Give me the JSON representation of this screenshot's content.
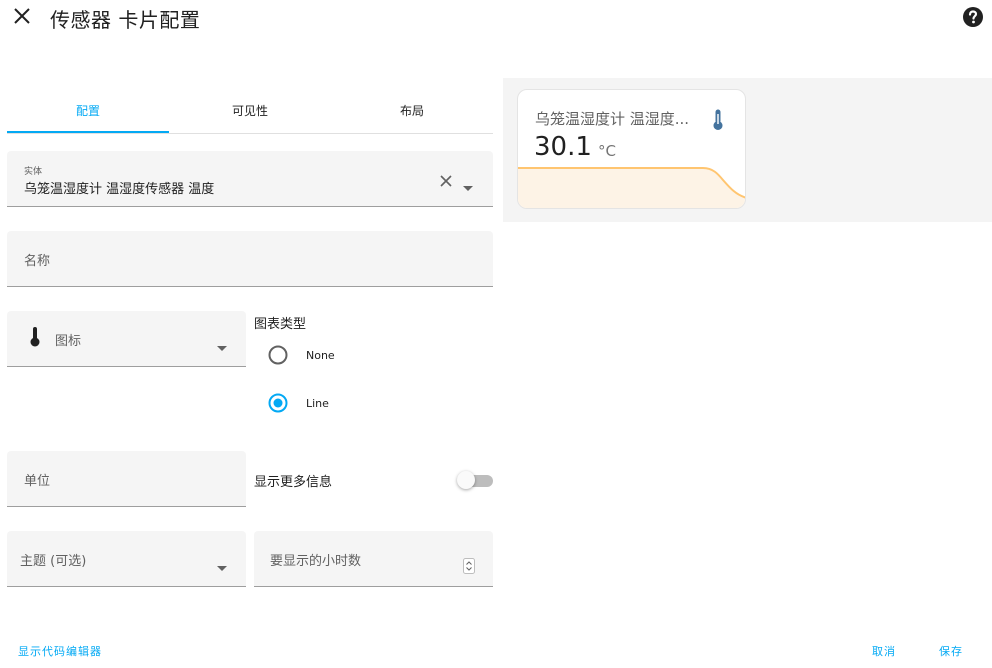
{
  "header": {
    "title": "传感器 卡片配置",
    "close_icon": "close-icon",
    "help_icon": "help-circle-icon"
  },
  "tabs": [
    {
      "label": "配置",
      "active": true
    },
    {
      "label": "可见性",
      "active": false
    },
    {
      "label": "布局",
      "active": false
    }
  ],
  "form": {
    "entity": {
      "label": "实体",
      "value": "乌笼温湿度计  温湿度传感器 温度"
    },
    "name": {
      "placeholder": "名称"
    },
    "icon": {
      "placeholder": "图标",
      "icon": "thermometer-icon"
    },
    "chart_type": {
      "label": "图表类型",
      "options": [
        {
          "label": "None",
          "selected": false
        },
        {
          "label": "Line",
          "selected": true
        }
      ]
    },
    "unit": {
      "placeholder": "单位"
    },
    "show_more_info": {
      "label": "显示更多信息",
      "enabled": false
    },
    "theme": {
      "placeholder": "主题 (可选)"
    },
    "hours_to_show": {
      "placeholder": "要显示的小时数"
    }
  },
  "footer": {
    "code_editor_label": "显示代码编辑器",
    "cancel_label": "取消",
    "save_label": "保存"
  },
  "preview_card": {
    "name": "乌笼温湿度计 温湿度...",
    "value": "30.1",
    "unit": "°C",
    "icon": "thermometer-icon"
  },
  "colors": {
    "accent": "#03a9f4",
    "graph_line": "#ffc570",
    "graph_fill": "#fdf3e6",
    "icon_blue": "#44739e"
  }
}
